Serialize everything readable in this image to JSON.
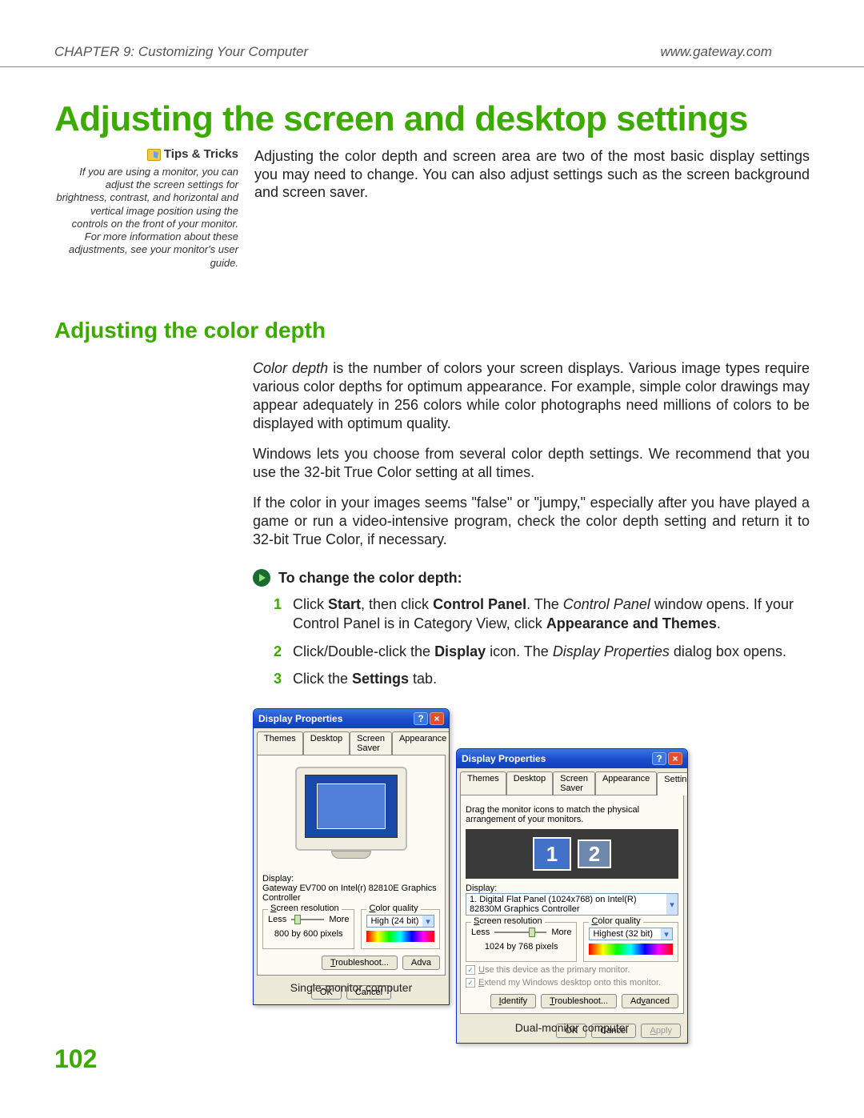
{
  "header": {
    "chapter": "CHAPTER 9: Customizing Your Computer",
    "url": "www.gateway.com"
  },
  "title": "Adjusting the screen and desktop settings",
  "tips": {
    "heading": "Tips & Tricks",
    "body": "If you are using a monitor, you can adjust the screen settings for brightness, contrast, and horizontal and vertical image position using the controls on the front of your monitor. For more information about these adjustments, see your monitor's user guide."
  },
  "intro": "Adjusting the color depth and screen area are two of the most basic display settings you may need to change. You can also adjust settings such as the screen background and screen saver.",
  "section": {
    "title": "Adjusting the color depth",
    "p1_lead_term": "Color depth",
    "p1_rest": " is the number of colors your screen displays. Various image types require various color depths for optimum appearance. For example, simple color drawings may appear adequately in 256 colors while color photographs need millions of colors to be displayed with optimum quality.",
    "p2": "Windows lets you choose from several color depth settings. We recommend that you use the 32-bit True Color setting at all times.",
    "p3": "If the color in your images seems \"false\" or \"jumpy,\" especially after you have played a game or run a video-intensive program, check the color depth setting and return it to 32-bit True Color, if necessary."
  },
  "procedure": {
    "title": "To change the color depth:",
    "steps": {
      "s1_a": "Click ",
      "s1_b1": "Start",
      "s1_c": ", then click ",
      "s1_b2": "Control Panel",
      "s1_d": ". The ",
      "s1_i": "Control Panel",
      "s1_e": " window opens. If your Control Panel is in Category View, click ",
      "s1_b3": "Appearance and Themes",
      "s1_f": ".",
      "s2_a": "Click/Double-click the ",
      "s2_b": "Display",
      "s2_c": " icon. The ",
      "s2_i": "Display Properties",
      "s2_d": " dialog box opens.",
      "s3_a": "Click the ",
      "s3_b": "Settings",
      "s3_c": " tab."
    }
  },
  "win_common": {
    "title": "Display Properties",
    "tabs": {
      "themes": "Themes",
      "desktop": "Desktop",
      "saver": "Screen Saver",
      "appearance": "Appearance",
      "settings": "Settings"
    },
    "display_label": "Display:",
    "res_legend_u": "S",
    "res_legend_rest": "creen resolution",
    "color_legend_u": "C",
    "color_legend_rest": "olor quality",
    "less": "Less",
    "more": "More",
    "ok": "OK",
    "cancel": "Cancel",
    "apply_u": "A",
    "apply_rest": "pply",
    "troubleshoot_u": "T",
    "troubleshoot_rest": "roubleshoot...",
    "advanced_pre": "Ad",
    "advanced_u": "v",
    "advanced_post": "anced",
    "identify_u": "I",
    "identify_rest": "dentify"
  },
  "win1": {
    "display_value": "Gateway EV700 on Intel(r) 82810E Graphics Controller",
    "res_text": "800 by 600 pixels",
    "color_value": "High (24 bit)",
    "adv_short": "Adva",
    "caption": "Single-monitor computer"
  },
  "win2": {
    "instruction": "Drag the monitor icons to match the physical arrangement of your monitors.",
    "display_value": "1. Digital Flat Panel (1024x768) on Intel(R) 82830M Graphics Controller",
    "res_text": "1024 by 768 pixels",
    "color_value": "Highest (32 bit)",
    "mon1": "1",
    "mon2": "2",
    "chk1_u": "U",
    "chk1_rest": "se this device as the primary monitor.",
    "chk2_u": "E",
    "chk2_rest": "xtend my Windows desktop onto this monitor.",
    "caption": "Dual-monitor computer"
  },
  "page_number": "102"
}
